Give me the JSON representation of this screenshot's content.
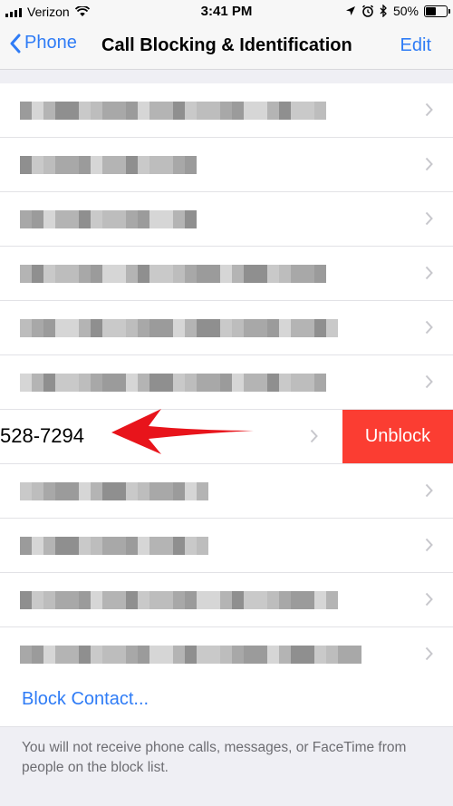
{
  "status_bar": {
    "carrier": "Verizon",
    "time": "3:41 PM",
    "battery": "50%"
  },
  "nav": {
    "back_label": "Phone",
    "title": "Call Blocking & Identification",
    "edit_label": "Edit"
  },
  "swiped_row": {
    "number": "528-7294",
    "action_label": "Unblock"
  },
  "block_contact_label": "Block Contact...",
  "footer_note": "You will not receive phone calls, messages, or FaceTime from people on the block list.",
  "colors": {
    "accent": "#2f7cf6",
    "destructive": "#fb3d32"
  }
}
